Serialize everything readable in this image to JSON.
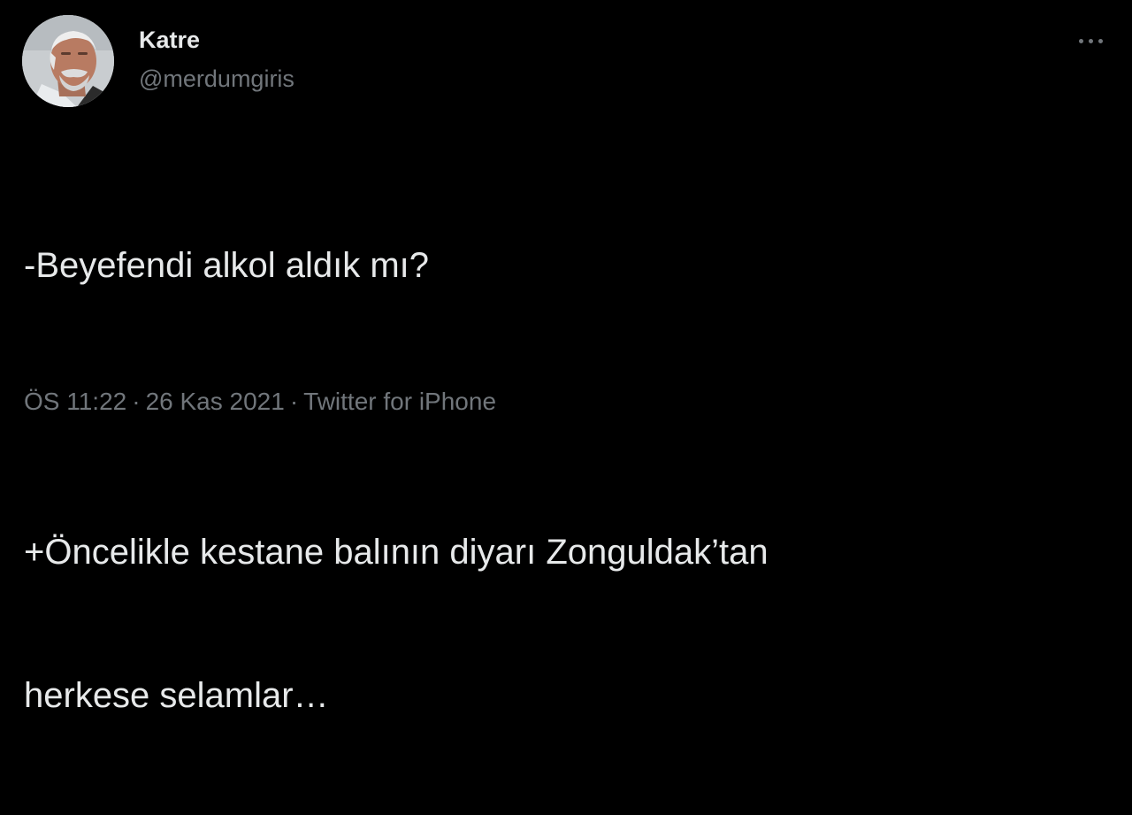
{
  "tweet": {
    "author": {
      "display_name": "Katre",
      "handle": "@merdumgiris",
      "avatar_icon": "profile-photo"
    },
    "more_icon": "more-horizontal-icon",
    "text_lines": [
      "-Beyefendi alkol aldık mı?",
      "",
      "+Öncelikle kestane balının diyarı Zonguldak’tan",
      "herkese selamlar…"
    ],
    "meta": {
      "time": "ÖS 11:22",
      "separator": "·",
      "date": "26 Kas 2021",
      "source": "Twitter for iPhone"
    }
  },
  "colors": {
    "background": "#000000",
    "primary_text": "#e7e9ea",
    "secondary_text": "#71767b"
  }
}
